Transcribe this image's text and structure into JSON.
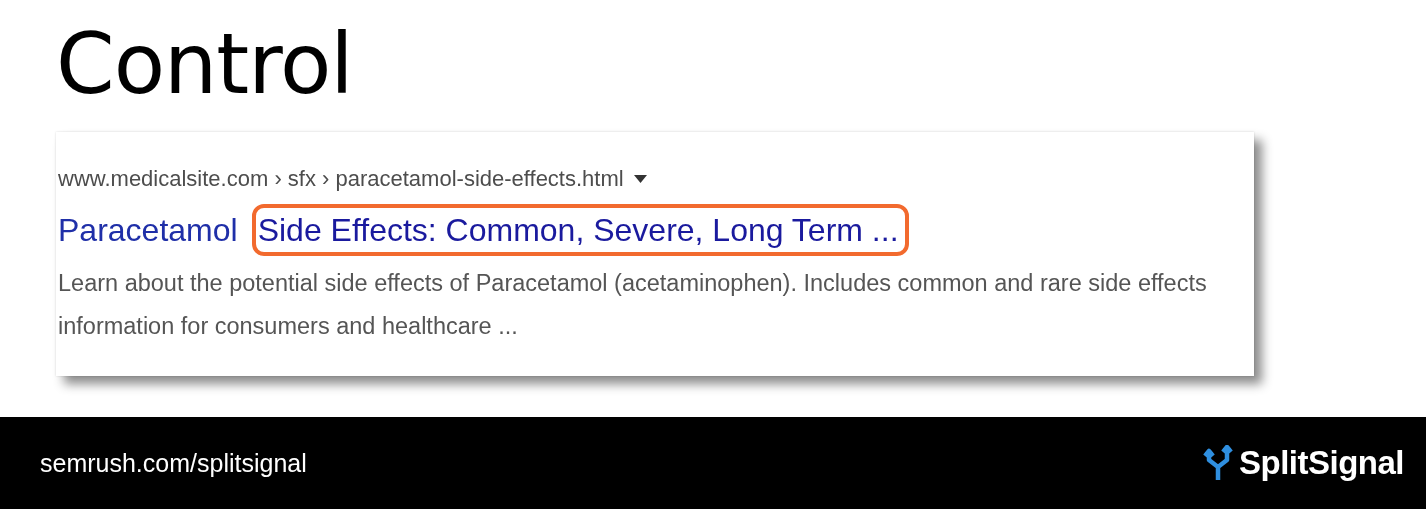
{
  "heading": "Control",
  "result": {
    "breadcrumb": "www.medicalsite.com › sfx › paracetamol-side-effects.html",
    "title_parts": [
      {
        "text": "Paracetamol",
        "highlighted": false
      },
      {
        "text": "Side Effects: Common, Severe, Long Term ...",
        "highlighted": true
      }
    ],
    "snippet": "Learn about the potential side effects of Paracetamol (acetaminophen). Includes common and rare side effects information for consumers and healthcare ..."
  },
  "footer": {
    "url": "semrush.com/splitsignal",
    "logo_text": "SplitSignal"
  }
}
